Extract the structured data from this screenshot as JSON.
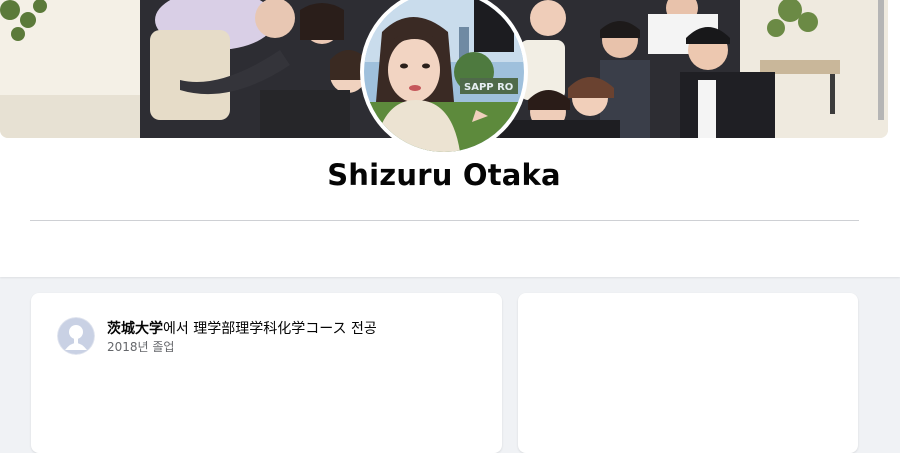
{
  "profile": {
    "name": "Shizuru Otaka"
  },
  "cover": {
    "sign_text": "SAPP  RO"
  },
  "education": {
    "school": "茨城大学",
    "suffix": "에서 理学部理学科化学コース 전공",
    "graduation": "2018년 졸업"
  },
  "colors": {
    "page_background": "#f0f2f5",
    "card_background": "#ffffff",
    "name_text": "#050505",
    "secondary_text": "#65676b",
    "avatar_placeholder": "#bcc0c4"
  },
  "icons": {
    "education": "default-avatar-icon"
  }
}
